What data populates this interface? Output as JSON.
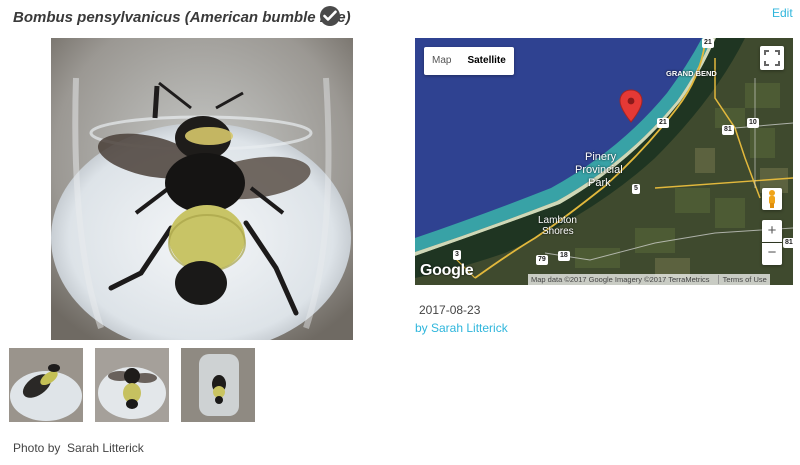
{
  "header": {
    "species_title": "Bombus pensylvanicus (American bumble bee)",
    "edit_label": "Edit",
    "verified_icon": "checkmark-circle-icon"
  },
  "photos": {
    "credit_prefix": "Photo by",
    "credit_name": "Sarah Litterick"
  },
  "map": {
    "type_options": [
      "Map",
      "Satellite"
    ],
    "selected_type": "Satellite",
    "labels": {
      "grand_bend": "GRAND BEND",
      "pinery": "Pinery",
      "provincial": "Provincial",
      "park": "Park",
      "lambton": "Lambton",
      "shores": "Shores"
    },
    "road_numbers": [
      "21",
      "21",
      "81",
      "10",
      "5",
      "3",
      "79",
      "18",
      "81"
    ],
    "google_logo": "Google",
    "attribution": "Map data ©2017 Google Imagery ©2017 TerraMetrics",
    "terms_label": "Terms of Use",
    "zoom_in_label": "+",
    "zoom_out_label": "−",
    "marker_color": "#e53935"
  },
  "observation": {
    "date": "2017-08-23",
    "observer": "by Sarah Litterick"
  },
  "colors": {
    "link": "#2fb6dc",
    "title": "#3a3a3a"
  }
}
